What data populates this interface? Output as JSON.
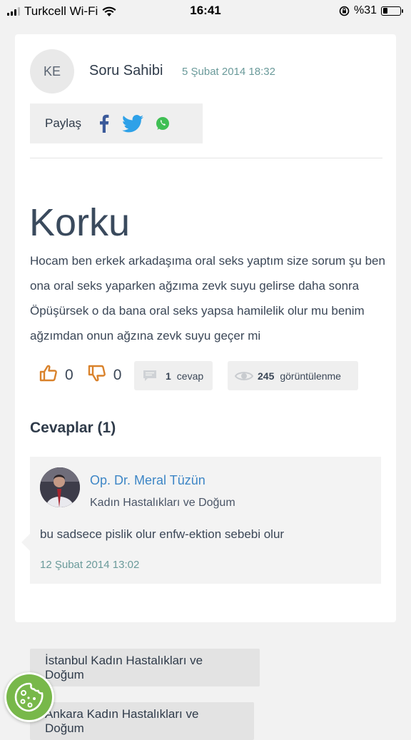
{
  "status_bar": {
    "carrier": "Turkcell Wi-Fi",
    "time": "16:41",
    "battery_text": "%31",
    "battery_level": 0.31
  },
  "question": {
    "avatar_initials": "KE",
    "author": "Soru Sahibi",
    "date": "5 Şubat 2014 18:32",
    "share_label": "Paylaş",
    "share_icons": [
      "facebook-icon",
      "twitter-icon",
      "whatsapp-icon"
    ],
    "title": "Korku",
    "body": "Hocam ben erkek arkadaşıma oral seks yaptım size sorum şu ben ona oral seks yaparken ağzıma zevk suyu gelirse daha sonra Öpüşürsek o da bana oral seks yapsa hamilelik olur mu benim ağzımdan onun ağzına zevk suyu geçer mi",
    "likes": "0",
    "dislikes": "0",
    "answers_count": "1",
    "answers_label": "cevap",
    "views_count": "245",
    "views_label": "görüntülenme"
  },
  "answers_section": {
    "heading": "Cevaplar (1)",
    "items": [
      {
        "doctor_name": "Op. Dr. Meral Tüzün",
        "specialty": "Kadın Hastalıkları ve Doğum",
        "text": "bu sadsece pislik olur enfw-ektion sebebi olur",
        "date": "12 Şubat 2014 13:02"
      }
    ]
  },
  "tags": [
    "İstanbul Kadın Hastalıkları ve Doğum",
    "Ankara Kadın Hastalıkları ve Doğum"
  ],
  "colors": {
    "accent_blue": "#3d86c6",
    "date_teal": "#6a9a9a",
    "vote_orange": "#d9822b",
    "cookie_green": "#78b84a"
  }
}
